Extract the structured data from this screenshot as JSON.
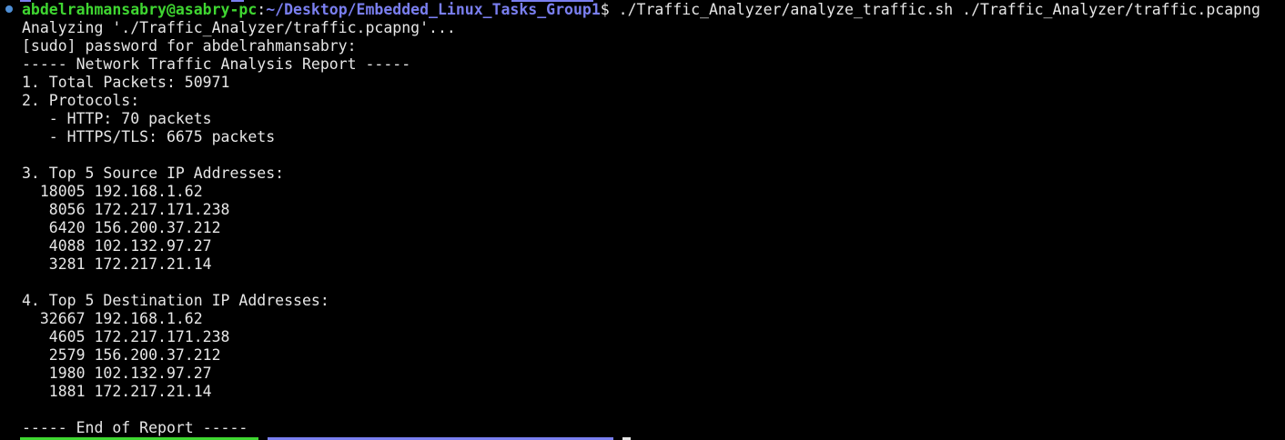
{
  "prompt": {
    "user_host": "abdelrahmansabry@asabry-pc",
    "separator": ":",
    "cwd": "~/Desktop/Embedded_Linux_Tasks_Group1",
    "symbol": "$ ",
    "command": "./Traffic_Analyzer/analyze_traffic.sh ./Traffic_Analyzer/traffic.pcapng"
  },
  "output": [
    "Analyzing './Traffic_Analyzer/traffic.pcapng'...",
    "[sudo] password for abdelrahmansabry:",
    "----- Network Traffic Analysis Report -----",
    "1. Total Packets: 50971",
    "2. Protocols:",
    "   - HTTP: 70 packets",
    "   - HTTPS/TLS: 6675 packets",
    "",
    "3. Top 5 Source IP Addresses:",
    "  18005 192.168.1.62",
    "   8056 172.217.171.238",
    "   6420 156.200.37.212",
    "   4088 102.132.97.27",
    "   3281 172.217.21.14",
    "",
    "4. Top 5 Destination IP Addresses:",
    "  32667 192.168.1.62",
    "   4605 172.217.171.238",
    "   2579 156.200.37.212",
    "   1980 102.132.97.27",
    "   1881 172.217.21.14",
    "",
    "----- End of Report -----"
  ],
  "colors": {
    "background": "#000000",
    "text": "#e6e6e6",
    "user_host": "#3fd631",
    "path": "#7a7ff0",
    "marker": "#4f8fd6"
  }
}
